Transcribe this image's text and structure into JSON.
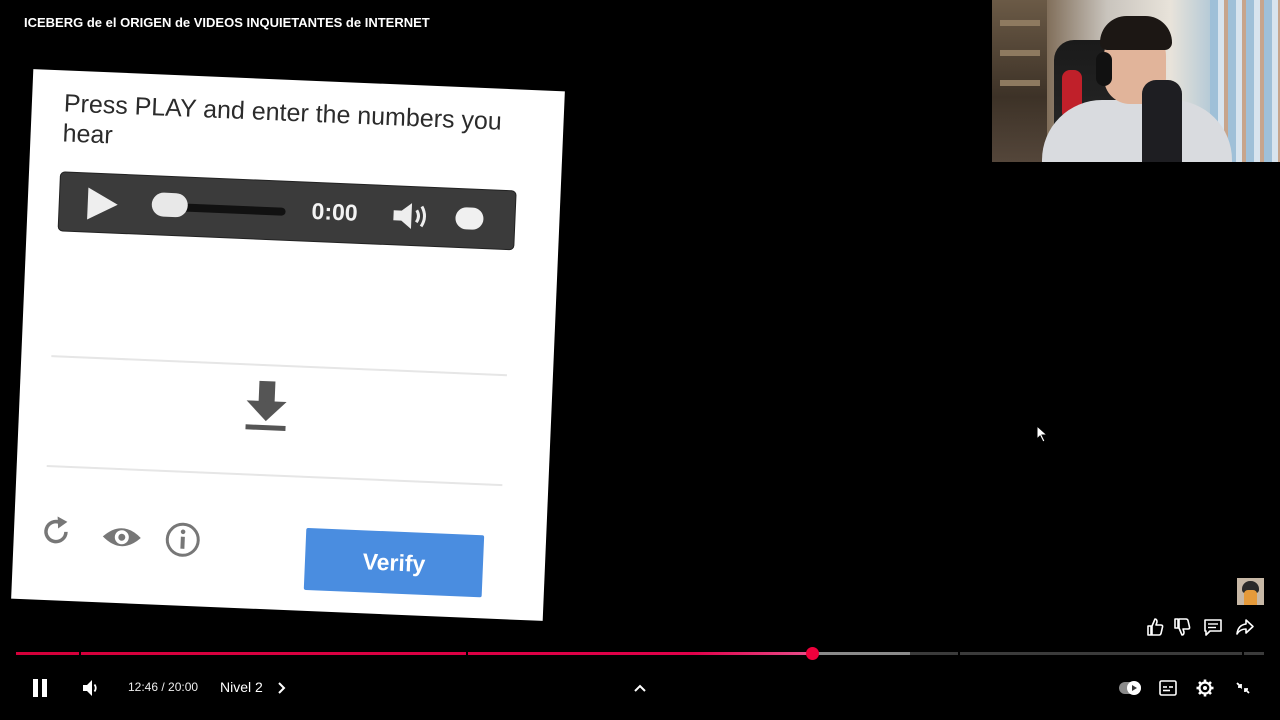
{
  "video": {
    "title": "ICEBERG de el ORIGEN de VIDEOS INQUIETANTES de INTERNET"
  },
  "captcha": {
    "prompt": "Press PLAY and enter the numbers you hear",
    "audio_time": "0:00",
    "verify_label": "Verify",
    "icons": [
      "play-icon",
      "volume-icon",
      "download-icon",
      "refresh-icon",
      "eye-icon",
      "info-icon"
    ],
    "accent_color": "#4a8de0"
  },
  "player": {
    "current_time": "12:46",
    "duration": "20:00",
    "time_display": "12:46 / 20:00",
    "chapter": "Nivel 2",
    "progress_fraction": 0.638,
    "buffered_fraction": 0.716,
    "progress_color": "#f0003c",
    "state": "playing",
    "actions": [
      "like-icon",
      "dislike-icon",
      "comment-icon",
      "share-icon"
    ],
    "controls": [
      "pause-icon",
      "volume-icon",
      "chevron-right-icon",
      "chevron-up-icon",
      "autoplay-toggle",
      "subtitles-icon",
      "settings-icon",
      "exit-fullscreen-icon"
    ]
  }
}
